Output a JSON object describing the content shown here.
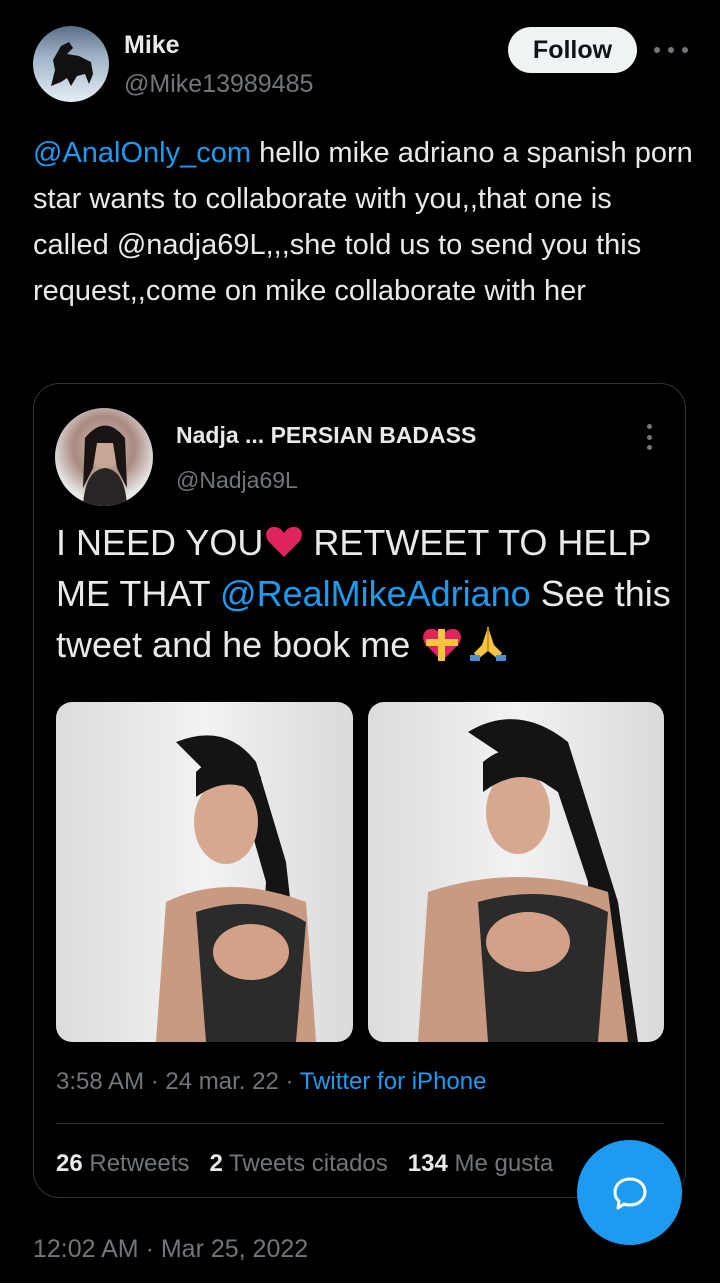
{
  "author": {
    "name": "Mike",
    "handle": "@Mike13989485",
    "follow_label": "Follow"
  },
  "tweet": {
    "mention": "@AnalOnly_com",
    "text": " hello mike adriano a spanish porn star wants to collaborate with you,,that one is called @nadja69L,,,she told us to send you this request,,come on mike collaborate with her"
  },
  "quoted": {
    "name": "Nadja ... PERSIAN BADASS",
    "handle": "@Nadja69L",
    "text_part1": "I NEED YOU",
    "text_part2": " RETWEET TO HELP ME THAT ",
    "mention": "@RealMikeAdriano",
    "text_part3": "  See this tweet and he book me ",
    "time": "3:58 AM",
    "date": "24 mar. 22",
    "source": "Twitter for iPhone",
    "sep": " · ",
    "retweets_count": "26",
    "retweets_label": " Retweets",
    "quotes_count": "2",
    "quotes_label": " Tweets citados",
    "likes_count": "134",
    "likes_label": " Me gusta"
  },
  "timestamp": "12:02 AM · Mar 25, 2022",
  "icons": {
    "more": "more-horizontal-icon",
    "quoted_more": "more-vertical-icon",
    "heart": "red-heart-emoji",
    "ribbon_heart": "heart-with-ribbon-emoji",
    "pray": "folded-hands-emoji",
    "fab": "reply-bubble-icon"
  },
  "colors": {
    "background": "#000000",
    "accent": "#1d9bf0",
    "muted": "#71767b",
    "text": "#e7e9ea"
  }
}
